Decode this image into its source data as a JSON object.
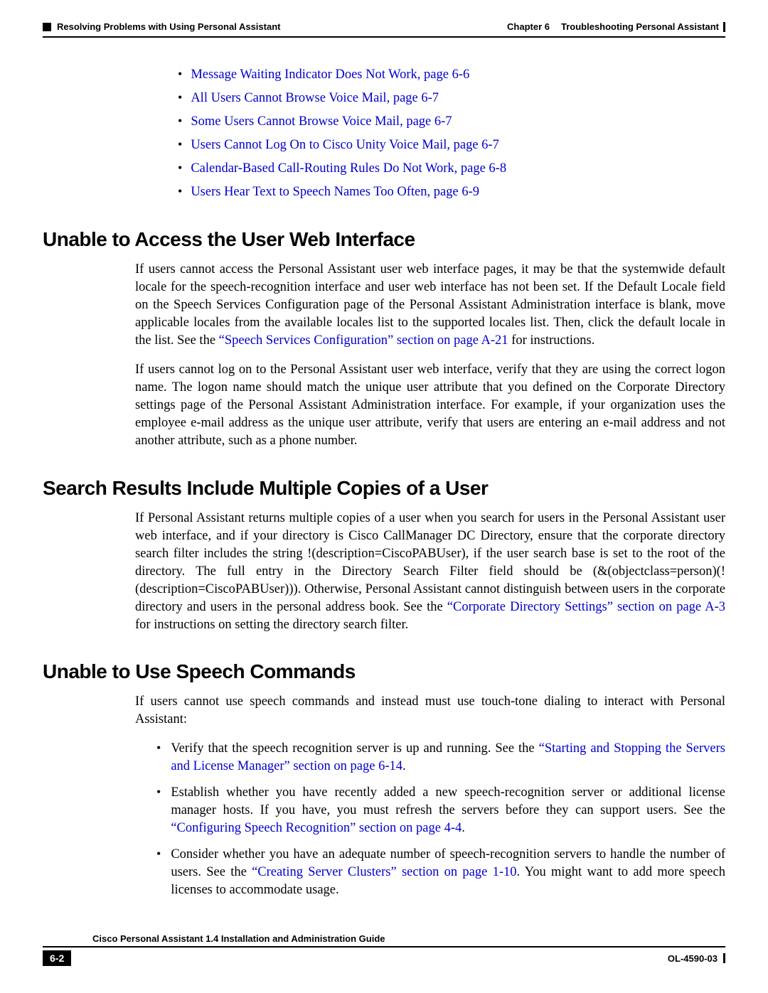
{
  "header": {
    "chapter_label": "Chapter 6",
    "chapter_title": "Troubleshooting Personal Assistant",
    "section_path": "Resolving Problems with Using Personal Assistant"
  },
  "top_links": [
    "Message Waiting Indicator Does Not Work, page 6-6",
    "All Users Cannot Browse Voice Mail, page 6-7",
    "Some Users Cannot Browse Voice Mail, page 6-7",
    "Users Cannot Log On to Cisco Unity Voice Mail, page 6-7",
    "Calendar-Based Call-Routing Rules Do Not Work, page 6-8",
    "Users Hear Text to Speech Names Too Often, page 6-9"
  ],
  "sections": {
    "s1": {
      "heading": "Unable to Access the User Web Interface",
      "p1_a": "If users cannot access the Personal Assistant user web interface pages, it may be that the systemwide default locale for the speech-recognition interface and user web interface has not been set. If the Default Locale field on the Speech Services Configuration page of the Personal Assistant Administration interface is blank, move applicable locales from the available locales list to the supported locales list. Then, click the default locale in the list. See the ",
      "p1_link": "“Speech Services Configuration” section on page A-21",
      "p1_b": " for instructions.",
      "p2": "If users cannot log on to the Personal Assistant user web interface, verify that they are using the correct logon name. The logon name should match the unique user attribute that you defined on the Corporate Directory settings page of the Personal Assistant Administration interface. For example, if your organization uses the employee e-mail address as the unique user attribute, verify that users are entering an e-mail address and not another attribute, such as a phone number."
    },
    "s2": {
      "heading": "Search Results Include Multiple Copies of a User",
      "p1_a": "If Personal Assistant returns multiple copies of a user when you search for users in the Personal Assistant user web interface, and if your directory is Cisco CallManager DC Directory, ensure that the corporate directory search filter includes the string !(description=CiscoPABUser), if the user search base is set to the root of the directory. The full entry in the Directory Search Filter field should be (&(objectclass=person)(!(description=CiscoPABUser))). Otherwise, Personal Assistant cannot distinguish between users in the corporate directory and users in the personal address book. See the ",
      "p1_link": "“Corporate Directory Settings” section on page A-3",
      "p1_b": " for instructions on setting the directory search filter."
    },
    "s3": {
      "heading": "Unable to Use Speech Commands",
      "intro": "If users cannot use speech commands and instead must use touch-tone dialing to interact with Personal Assistant:",
      "b1_a": "Verify that the speech recognition server is up and running. See the ",
      "b1_link": "“Starting and Stopping the Servers and License Manager” section on page 6-14",
      "b1_b": ".",
      "b2_a": "Establish whether you have recently added a new speech-recognition server or additional license manager hosts. If you have, you must refresh the servers before they can support users. See the ",
      "b2_link": "“Configuring Speech Recognition” section on page 4-4",
      "b2_b": ".",
      "b3_a": "Consider whether you have an adequate number of speech-recognition servers to handle the number of users. See the ",
      "b3_link": "“Creating Server Clusters” section on page 1-10",
      "b3_b": ". You might want to add more speech licenses to accommodate usage."
    }
  },
  "footer": {
    "guide_title": "Cisco Personal Assistant 1.4 Installation and Administration Guide",
    "page_number": "6-2",
    "doc_id": "OL-4590-03"
  }
}
